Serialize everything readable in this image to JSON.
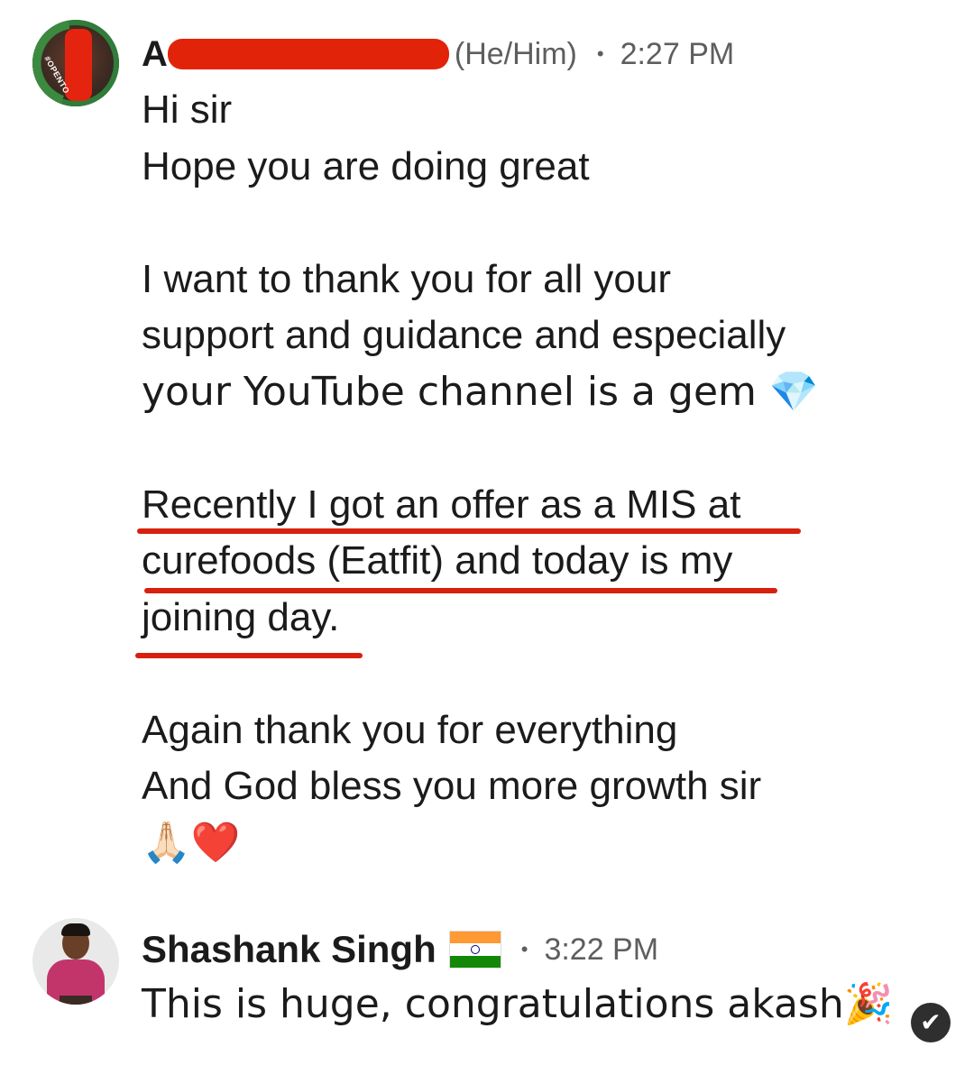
{
  "messages": [
    {
      "sender_initial": "A",
      "pronouns": "(He/Him)",
      "separator": "•",
      "time": "2:27 PM",
      "avatar_badge_text": "#OPENTO",
      "lines": {
        "greeting": "Hi sir",
        "hope": "Hope you are doing great",
        "thanks_1": "I want to thank you for all your",
        "thanks_2": "support and guidance and especially",
        "thanks_3": "your YouTube channel is a gem 💎",
        "offer_1": "Recently I got an offer as a MIS at",
        "offer_2": "curefoods (Eatfit) and today is my",
        "offer_3": "joining day.",
        "again": "Again thank you for everything",
        "bless": "And God bless you more growth sir",
        "emojis": "🙏🏻❤️"
      }
    },
    {
      "sender_name": "Shashank Singh",
      "separator": "•",
      "time": "3:22 PM",
      "text": "This is huge, congratulations akash🎉"
    }
  ],
  "colors": {
    "highlight": "#d7200e",
    "redaction": "#e12409",
    "meta_text": "#5e5e5e"
  },
  "icons": {
    "flag": "india-flag-icon",
    "seen": "checkmark-icon",
    "seen_glyph": "✔"
  }
}
